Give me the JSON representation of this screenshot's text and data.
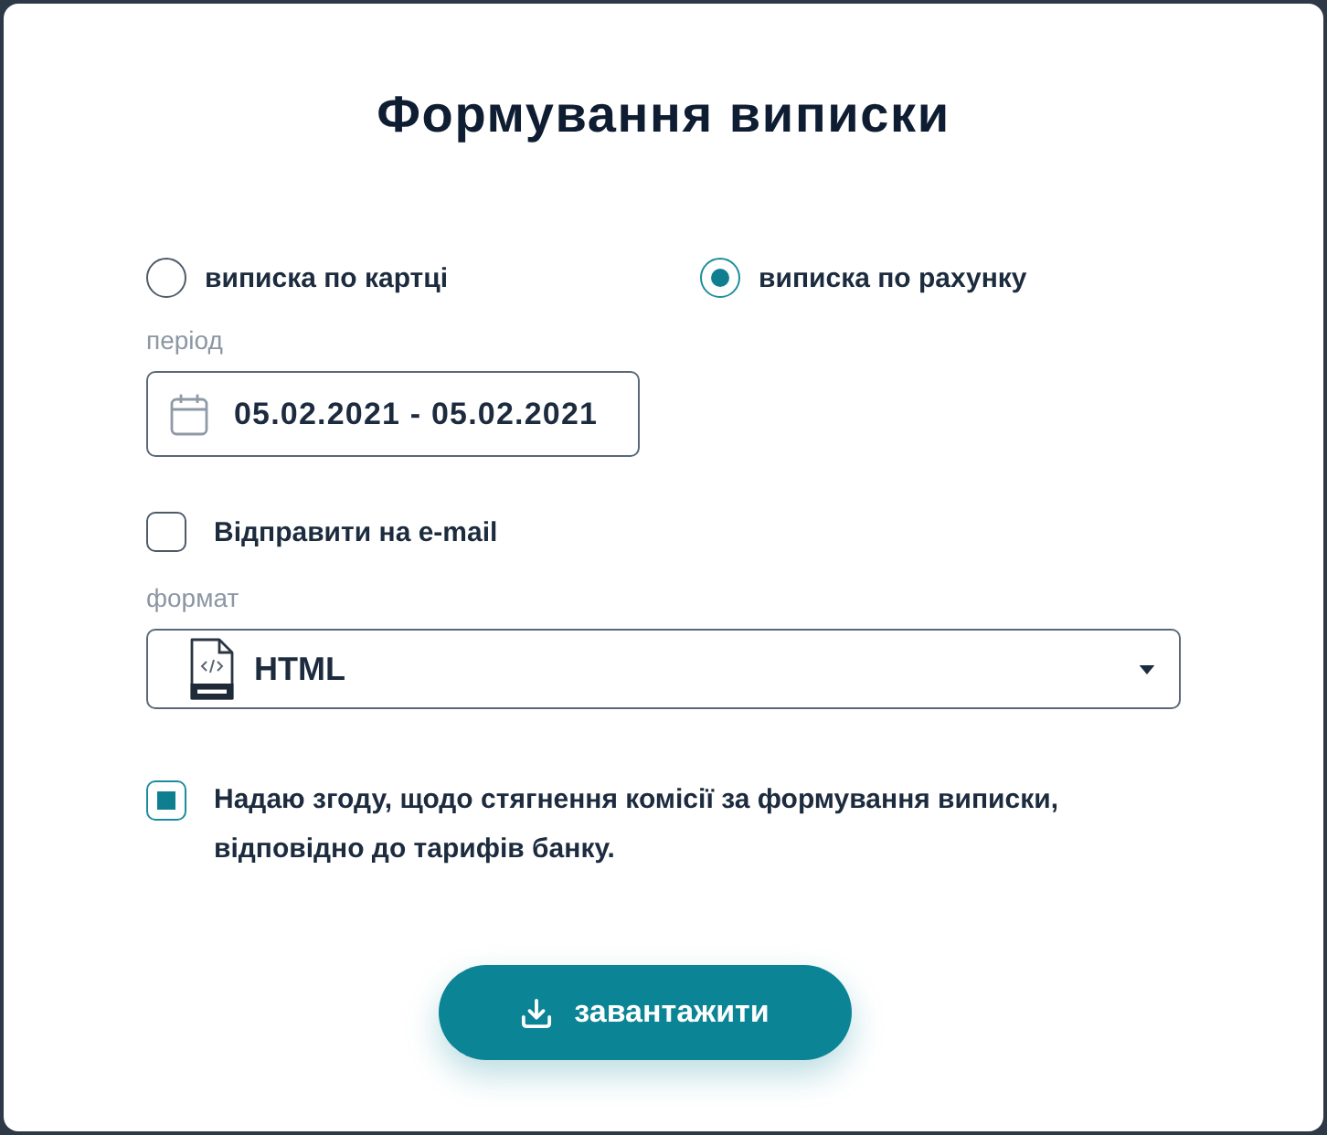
{
  "dialog": {
    "title": "Формування виписки"
  },
  "statement_type": [
    {
      "label": "виписка по картці",
      "selected": false
    },
    {
      "label": "виписка по рахунку",
      "selected": true
    }
  ],
  "period": {
    "label": "період",
    "value": "05.02.2021 - 05.02.2021"
  },
  "send_email": {
    "label": "Відправити на e-mail",
    "checked": false
  },
  "format": {
    "label": "формат",
    "value": "HTML"
  },
  "consent": {
    "text": "Надаю згоду, щодо стягнення комісії за формування виписки, відповідно до тарифів банку.",
    "checked": true
  },
  "download_button": {
    "label": "завантажити"
  }
}
